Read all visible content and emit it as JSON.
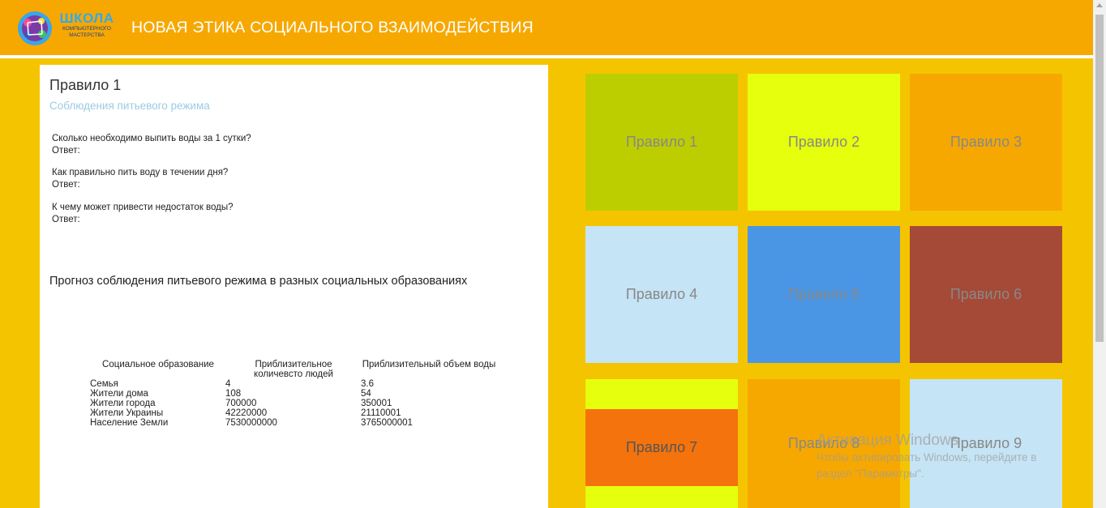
{
  "header": {
    "logo_big": "ШКОЛА",
    "logo_small_1": "КОМПЬЮТЕРНОГО",
    "logo_small_2": "МАСТЕРСТВА",
    "title": "НОВАЯ ЭТИКА СОЦИАЛЬНОГО ВЗАИМОДЕЙСТВИЯ"
  },
  "panel": {
    "title": "Правило 1",
    "subtitle": "Соблюдения питьевого режима",
    "questions": [
      {
        "q": "Сколько необходимо выпить воды за 1 сутки?",
        "a": "Ответ:"
      },
      {
        "q": "Как правильно пить воду в течении дня?",
        "a": "Ответ:"
      },
      {
        "q": "К чему может привести недостаток воды?",
        "a": "Ответ:"
      }
    ],
    "forecast_title": "Прогноз соблюдения питьевого режима в разных социальных образованиях",
    "table": {
      "headers": [
        "Социальное образование",
        "Приблизительное количевсто людей",
        "Приблизительный объем воды"
      ],
      "rows": [
        [
          "Семья",
          "4",
          "3.6"
        ],
        [
          "Жители дома",
          "108",
          "54"
        ],
        [
          "Жители города",
          "700000",
          "350001"
        ],
        [
          "Жители Украины",
          "42220000",
          "21110001"
        ],
        [
          "Население Земли",
          "7530000000",
          "3765000001"
        ]
      ]
    }
  },
  "tiles": [
    {
      "label": "Правило 1",
      "color": "#bdce00"
    },
    {
      "label": "Правило 2",
      "color": "#e5ff0c"
    },
    {
      "label": "Правило 3",
      "color": "#f6a800"
    },
    {
      "label": "Правило 4",
      "color": "#c5e4f5"
    },
    {
      "label": "Правило 5",
      "color": "#4a96e4"
    },
    {
      "label": "Правило 6",
      "color": "#a54a37"
    },
    {
      "label": "Правило 7",
      "color": "#f4730c"
    },
    {
      "label": "Правило 8",
      "color": "#f6a800"
    },
    {
      "label": "Правило 9",
      "color": "#c5e4f5"
    }
  ],
  "watermark": {
    "line1": "Активация Windows",
    "line2": "Чтобы активировать Windows, перейдите в",
    "line3": "раздел \"Параметры\"."
  }
}
